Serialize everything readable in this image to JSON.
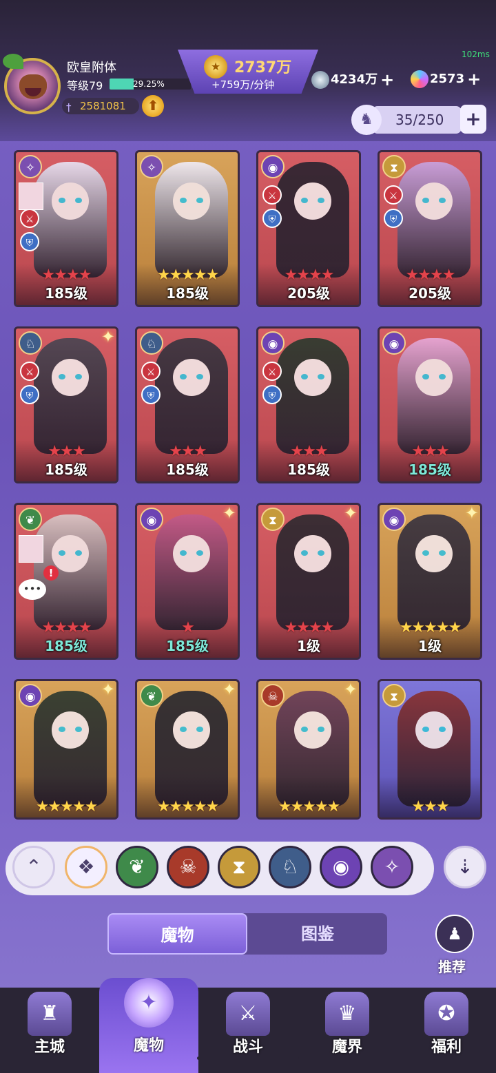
{
  "player": {
    "name": "欧皇附体",
    "level": "等级79",
    "exp_pct": "29.25%",
    "exp_fraction": 0.2925,
    "power": "2581081"
  },
  "gold": {
    "amount": "2737万",
    "rate": "+759万/分钟"
  },
  "ping": "102ms",
  "resources": [
    {
      "amount": "4234万",
      "icon": "silver-gem-icon"
    },
    {
      "amount": "2573",
      "icon": "crystal-icon"
    }
  ],
  "capacity": "35/250",
  "monsters": [
    {
      "element": "light-swirl",
      "bg": "red",
      "stars": 4,
      "star_color": "red",
      "level": "185级",
      "roles": [
        "atk",
        "def"
      ],
      "avatar_badge": true
    },
    {
      "element": "light-swirl",
      "bg": "gold",
      "stars": 5,
      "star_color": "gold",
      "level": "185级",
      "roles": []
    },
    {
      "element": "eye",
      "bg": "red",
      "stars": 4,
      "star_color": "red",
      "level": "205级",
      "roles": [
        "atk",
        "def"
      ]
    },
    {
      "element": "hourglass",
      "bg": "red",
      "stars": 4,
      "star_color": "red",
      "level": "205级",
      "roles": [
        "atk",
        "def"
      ]
    },
    {
      "element": "dragon",
      "bg": "red",
      "stars": 3,
      "star_color": "red",
      "level": "185级",
      "roles": [
        "atk",
        "def"
      ],
      "sparkle": true
    },
    {
      "element": "dragon",
      "bg": "red",
      "stars": 3,
      "star_color": "red",
      "level": "185级",
      "roles": [
        "atk",
        "def"
      ]
    },
    {
      "element": "eye",
      "bg": "red",
      "stars": 3,
      "star_color": "red",
      "level": "185级",
      "roles": [
        "atk",
        "def"
      ]
    },
    {
      "element": "eye",
      "bg": "red",
      "stars": 3,
      "star_color": "red",
      "level": "185级",
      "level_color": "teal",
      "roles": []
    },
    {
      "element": "leaf",
      "bg": "red",
      "stars": 4,
      "star_color": "red",
      "level": "185级",
      "level_color": "teal",
      "roles": [],
      "avatar_badge": true,
      "alert": true
    },
    {
      "element": "eye",
      "bg": "red",
      "stars": 1,
      "star_color": "red",
      "level": "185级",
      "level_color": "teal",
      "roles": [],
      "sparkle": true
    },
    {
      "element": "hourglass",
      "bg": "red",
      "stars": 4,
      "star_color": "red",
      "level": "1级",
      "roles": [],
      "sparkle": true
    },
    {
      "element": "eye",
      "bg": "gold",
      "stars": 5,
      "star_color": "gold",
      "level": "1级",
      "roles": [],
      "sparkle": true
    },
    {
      "element": "eye",
      "bg": "gold",
      "stars": 5,
      "star_color": "gold",
      "level": "",
      "roles": [],
      "sparkle": true
    },
    {
      "element": "leaf",
      "bg": "gold",
      "stars": 5,
      "star_color": "gold",
      "level": "",
      "roles": [],
      "sparkle": true
    },
    {
      "element": "skull",
      "bg": "gold",
      "stars": 5,
      "star_color": "gold",
      "level": "",
      "roles": [],
      "sparkle": true
    },
    {
      "element": "hourglass",
      "bg": "blue",
      "stars": 3,
      "star_color": "gold",
      "level": "",
      "roles": []
    }
  ],
  "filters": [
    {
      "name": "collapse",
      "icon": "double-chevron-up-icon"
    },
    {
      "name": "all",
      "icon": "diamond-grid-icon",
      "selected": true
    },
    {
      "name": "nature",
      "icon": "leaf-icon"
    },
    {
      "name": "demon",
      "icon": "skull-icon"
    },
    {
      "name": "time",
      "icon": "hourglass-icon"
    },
    {
      "name": "beast",
      "icon": "dragon-icon"
    },
    {
      "name": "arcane",
      "icon": "eye-icon"
    },
    {
      "name": "light",
      "icon": "swirl-icon"
    }
  ],
  "tabs": {
    "active": "魔物",
    "inactive": "图鉴"
  },
  "recommend_label": "推荐",
  "nav": [
    {
      "label": "主城",
      "icon": "castle-icon"
    },
    {
      "label": "魔物",
      "icon": "monster-flame-icon",
      "active": true
    },
    {
      "label": "战斗",
      "icon": "sword-shield-icon"
    },
    {
      "label": "魔界",
      "icon": "demon-realm-icon"
    },
    {
      "label": "福利",
      "icon": "treasure-chest-icon"
    }
  ],
  "colors": {
    "star_red": "#e4434b",
    "star_gold": "#ffd54a",
    "exp_fill": "#4ed6b4",
    "gold_text": "#ffd874"
  }
}
